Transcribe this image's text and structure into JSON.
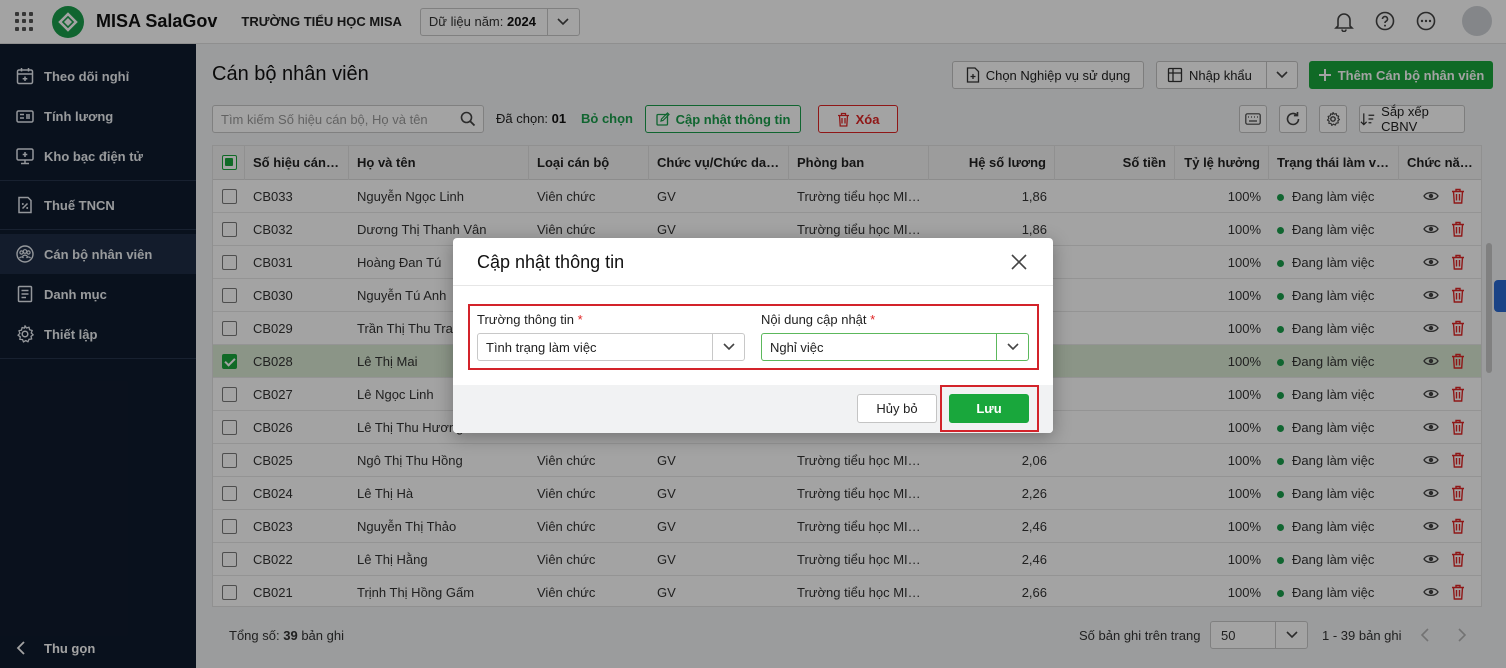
{
  "topbar": {
    "brand": "MISA SalaGov",
    "school": "TRƯỜNG TIỂU HỌC MISA",
    "year_label": "Dữ liệu năm:",
    "year_value": "2024"
  },
  "sidebar": {
    "items": [
      {
        "label": "Theo dõi nghỉ",
        "icon": "calendar-plus-icon"
      },
      {
        "label": "Tính lương",
        "icon": "salary-icon"
      },
      {
        "label": "Kho bạc điện tử",
        "icon": "treasury-icon"
      },
      {
        "label": "Thuế TNCN",
        "icon": "tax-document-icon"
      },
      {
        "label": "Cán bộ nhân viên",
        "icon": "staff-icon"
      },
      {
        "label": "Danh mục",
        "icon": "catalog-icon"
      },
      {
        "label": "Thiết lập",
        "icon": "settings-icon"
      }
    ],
    "active_index": 4,
    "collapse_label": "Thu gọn"
  },
  "page": {
    "title": "Cán bộ nhân viên",
    "btn_choose_service": "Chọn Nghiệp vụ sử dụng",
    "btn_import": "Nhập khẩu",
    "btn_add": "Thêm Cán bộ nhân viên",
    "search_placeholder": "Tìm kiếm Số hiệu cán bộ, Họ và tên",
    "selected_label": "Đã chọn:",
    "selected_count": "01",
    "deselect": "Bỏ chọn",
    "btn_update": "Cập nhật thông tin",
    "btn_delete": "Xóa",
    "btn_sort": "Sắp xếp CBNV"
  },
  "table": {
    "columns": [
      "Số hiệu cán bộ",
      "Họ và tên",
      "Loại cán bộ",
      "Chức vụ/Chức danh",
      "Phòng ban",
      "Hệ số lương",
      "Số tiền",
      "Tỷ lệ hưởng",
      "Trạng thái làm việc",
      "Chức năng"
    ],
    "rows": [
      {
        "code": "CB033",
        "name": "Nguyễn Ngọc Linh",
        "type": "Viên chức",
        "position": "GV",
        "dept": "Trường tiểu học MISA",
        "coef": "1,86",
        "amount": "",
        "rate": "100%",
        "status": "Đang làm việc",
        "checked": false
      },
      {
        "code": "CB032",
        "name": "Dương Thị Thanh Vân",
        "type": "Viên chức",
        "position": "GV",
        "dept": "Trường tiểu học MISA",
        "coef": "1,86",
        "amount": "",
        "rate": "100%",
        "status": "Đang làm việc",
        "checked": false
      },
      {
        "code": "CB031",
        "name": "Hoàng Đan Tú",
        "type": "",
        "position": "",
        "dept": "",
        "coef": "",
        "amount": "",
        "rate": "100%",
        "status": "Đang làm việc",
        "checked": false
      },
      {
        "code": "CB030",
        "name": "Nguyễn Tú Anh",
        "type": "",
        "position": "",
        "dept": "",
        "coef": "",
        "amount": "",
        "rate": "100%",
        "status": "Đang làm việc",
        "checked": false
      },
      {
        "code": "CB029",
        "name": "Trần Thị Thu Trang",
        "type": "",
        "position": "",
        "dept": "",
        "coef": "",
        "amount": "",
        "rate": "100%",
        "status": "Đang làm việc",
        "checked": false
      },
      {
        "code": "CB028",
        "name": "Lê Thị Mai",
        "type": "",
        "position": "",
        "dept": "",
        "coef": "",
        "amount": "",
        "rate": "100%",
        "status": "Đang làm việc",
        "checked": true
      },
      {
        "code": "CB027",
        "name": "Lê Ngọc Linh",
        "type": "",
        "position": "",
        "dept": "",
        "coef": "",
        "amount": "",
        "rate": "100%",
        "status": "Đang làm việc",
        "checked": false
      },
      {
        "code": "CB026",
        "name": "Lê Thị Thu Hương",
        "type": "",
        "position": "",
        "dept": "",
        "coef": "",
        "amount": "",
        "rate": "100%",
        "status": "Đang làm việc",
        "checked": false
      },
      {
        "code": "CB025",
        "name": "Ngô Thị Thu Hồng",
        "type": "Viên chức",
        "position": "GV",
        "dept": "Trường tiểu học MISA",
        "coef": "2,06",
        "amount": "",
        "rate": "100%",
        "status": "Đang làm việc",
        "checked": false
      },
      {
        "code": "CB024",
        "name": "Lê Thị Hà",
        "type": "Viên chức",
        "position": "GV",
        "dept": "Trường tiểu học MISA",
        "coef": "2,26",
        "amount": "",
        "rate": "100%",
        "status": "Đang làm việc",
        "checked": false
      },
      {
        "code": "CB023",
        "name": "Nguyễn Thị Thảo",
        "type": "Viên chức",
        "position": "GV",
        "dept": "Trường tiểu học MISA",
        "coef": "2,46",
        "amount": "",
        "rate": "100%",
        "status": "Đang làm việc",
        "checked": false
      },
      {
        "code": "CB022",
        "name": "Lê Thị Hằng",
        "type": "Viên chức",
        "position": "GV",
        "dept": "Trường tiểu học MISA",
        "coef": "2,46",
        "amount": "",
        "rate": "100%",
        "status": "Đang làm việc",
        "checked": false
      },
      {
        "code": "CB021",
        "name": "Trịnh Thị Hồng Gấm",
        "type": "Viên chức",
        "position": "GV",
        "dept": "Trường tiểu học MISA",
        "coef": "2,66",
        "amount": "",
        "rate": "100%",
        "status": "Đang làm việc",
        "checked": false
      }
    ]
  },
  "footer": {
    "total_label": "Tổng số:",
    "total_count": "39",
    "total_suffix": "bản ghi",
    "per_page_label": "Số bản ghi trên trang",
    "per_page_value": "50",
    "range": "1 - 39 bản ghi"
  },
  "dialog": {
    "title": "Cập nhật thông tin",
    "field1_label": "Trường thông tin",
    "field1_value": "Tình trạng làm việc",
    "field2_label": "Nội dung cập nhật",
    "field2_value": "Nghỉ việc",
    "required_mark": "*",
    "cancel": "Hủy bỏ",
    "save": "Lưu"
  },
  "colors": {
    "brand_green": "#19a73c",
    "sidebar_bg": "#0f1b2e",
    "highlight_red": "#d3232a",
    "delete_red": "#e02424"
  }
}
